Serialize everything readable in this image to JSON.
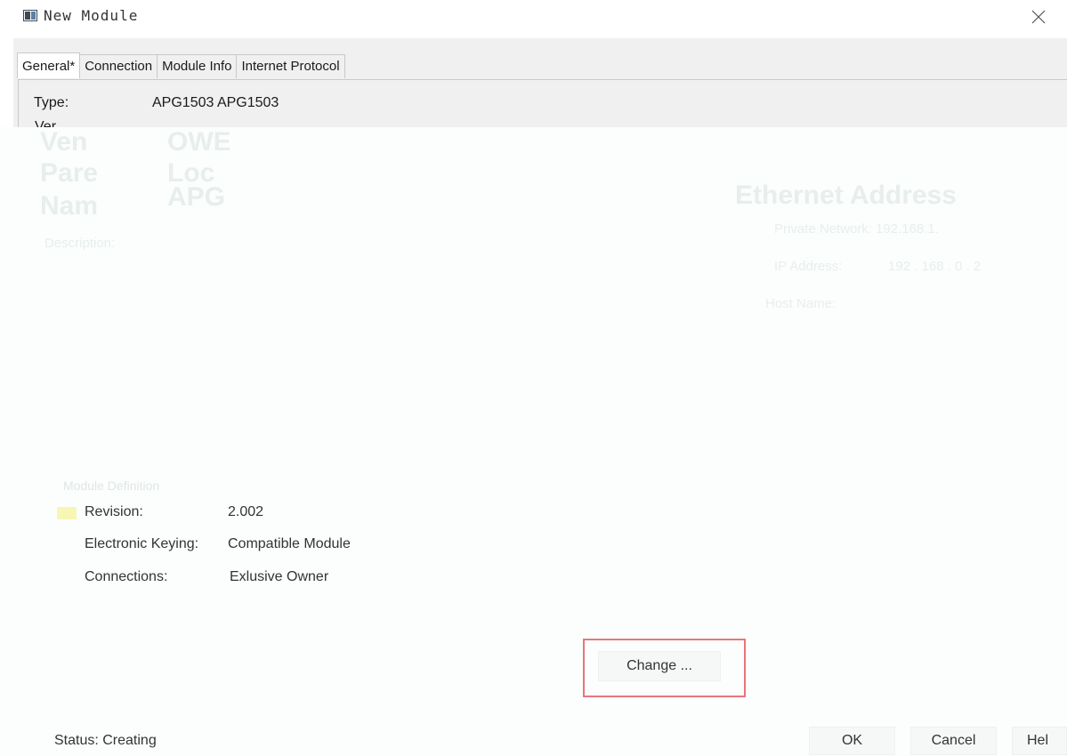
{
  "window": {
    "title": "New Module",
    "close_icon": "close-icon"
  },
  "tabs": [
    {
      "label": "General*",
      "active": true
    },
    {
      "label": "Connection",
      "active": false
    },
    {
      "label": "Module Info",
      "active": false
    },
    {
      "label": "Internet Protocol",
      "active": false
    }
  ],
  "general": {
    "type_label": "Type:",
    "type_value": "APG1503 APG1503",
    "vendor_label_partial": "Ver"
  },
  "ghost": {
    "description_label": "Description:",
    "ethernet_caption": "Ethernet Address",
    "private_network_label": "Private Network:",
    "private_network_value": "192.168.1.",
    "ip_address_label": "IP Address:",
    "ip_address_value": "192 . 168 . 0 . 2",
    "host_name_label": "Host Name:"
  },
  "module_definition": {
    "caption": "Module Definition",
    "rows": [
      {
        "label": "Revision:",
        "value": "2.002"
      },
      {
        "label": "Electronic Keying:",
        "value": "Compatible Module"
      },
      {
        "label": "Connections:",
        "value": "Exlusive Owner"
      }
    ],
    "change_button": "Change ..."
  },
  "footer": {
    "status": "Status: Creating",
    "ok_button": "OK",
    "cancel_button": "Cancel",
    "help_button": "Hel"
  },
  "colors": {
    "highlight": "#e8767a",
    "panel": "#f0f0f0"
  }
}
